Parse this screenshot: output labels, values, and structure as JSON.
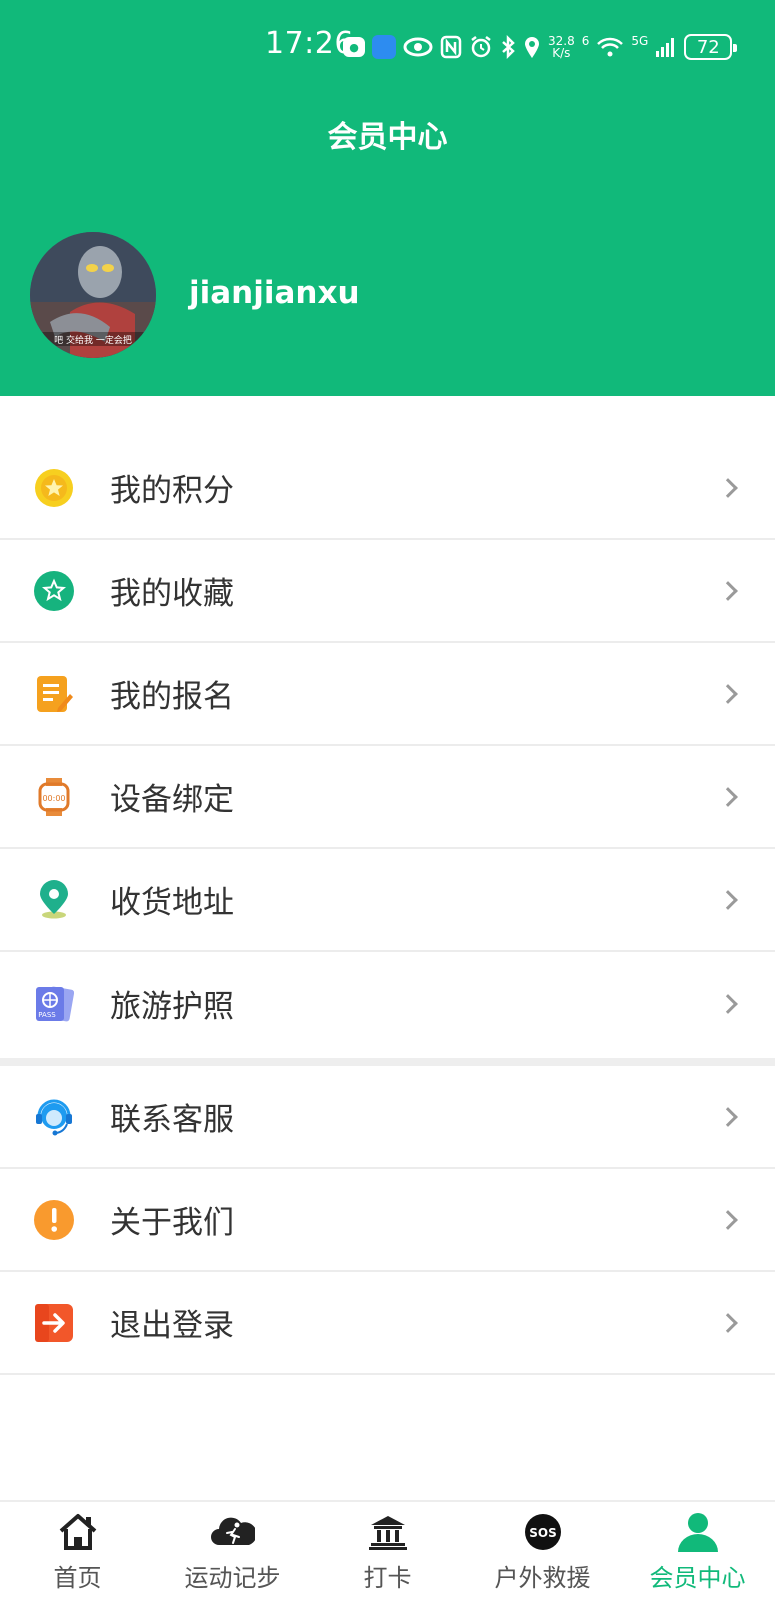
{
  "status_bar": {
    "time": "17:26",
    "net_speed_value": "32.8",
    "net_speed_unit": "K/s",
    "signal_label": "5G",
    "sim_label": "6",
    "battery": "72"
  },
  "header": {
    "title": "会员中心",
    "username": "jianjianxu",
    "avatar_caption": "吧 交给我 一定会把"
  },
  "menu": {
    "items": [
      {
        "label": "我的积分",
        "icon": "points-icon"
      },
      {
        "label": "我的收藏",
        "icon": "favorites-icon"
      },
      {
        "label": "我的报名",
        "icon": "registration-icon"
      },
      {
        "label": "设备绑定",
        "icon": "watch-icon"
      },
      {
        "label": "收货地址",
        "icon": "location-icon"
      },
      {
        "label": "旅游护照",
        "icon": "passport-icon"
      },
      {
        "label": "联系客服",
        "icon": "customer-service-icon"
      },
      {
        "label": "关于我们",
        "icon": "info-icon"
      },
      {
        "label": "退出登录",
        "icon": "logout-icon"
      }
    ]
  },
  "tabbar": {
    "tabs": [
      {
        "label": "首页",
        "icon": "home-icon"
      },
      {
        "label": "运动记步",
        "icon": "running-icon"
      },
      {
        "label": "打卡",
        "icon": "landmark-icon"
      },
      {
        "label": "户外救援",
        "icon": "sos-icon"
      },
      {
        "label": "会员中心",
        "icon": "user-icon"
      }
    ],
    "active_index": 4
  },
  "colors": {
    "brand": "#11b97a",
    "text": "#333333",
    "chevron": "#9a9a9a"
  }
}
